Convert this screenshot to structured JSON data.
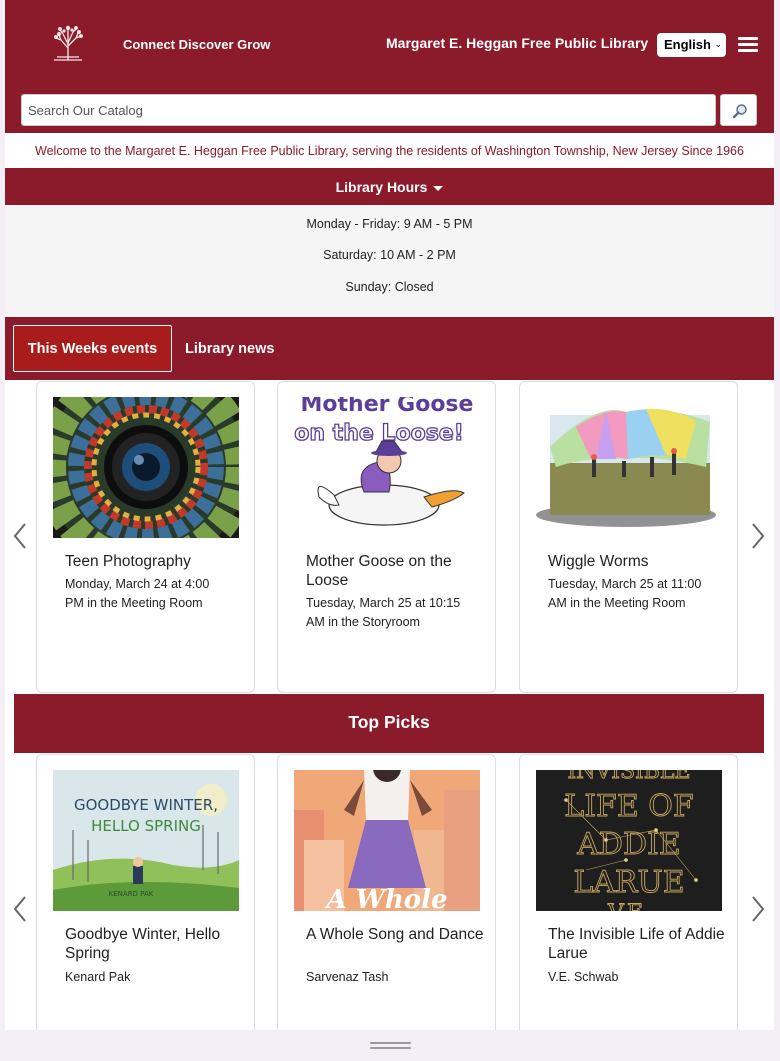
{
  "header": {
    "tagline": "Connect Discover Grow",
    "library_name": "Margaret E. Heggan Free Public Library",
    "language": "English"
  },
  "search": {
    "placeholder": "Search Our Catalog"
  },
  "welcome": "Welcome to the Margaret E. Heggan Free Public Library, serving the residents of Washington Township, New Jersey Since 1966",
  "hours": {
    "label": "Library Hours",
    "lines": [
      "Monday - Friday: 9 AM - 5 PM",
      "Saturday: 10 AM - 2 PM",
      "Sunday: Closed"
    ]
  },
  "tabs": [
    {
      "label": "This Weeks events",
      "active": true
    },
    {
      "label": "Library news",
      "active": false
    }
  ],
  "events": [
    {
      "title": "Teen Photography",
      "detail": "Monday, March 24 at 4:00 PM in the Meeting Room",
      "image": "camera-lens-mosaic"
    },
    {
      "title": "Mother Goose on the Loose",
      "detail": "Tuesday, March 25 at 10:15 AM in the Storyroom",
      "image": "mother-goose-illustration",
      "image_text": "Mother Goose on the Loose!"
    },
    {
      "title": "Wiggle Worms",
      "detail": "Tuesday, March 25 at 11:00 AM in the Meeting Room",
      "image": "parachute-play-illustration"
    }
  ],
  "top_picks": {
    "heading": "Top Picks",
    "items": [
      {
        "title": "Goodbye Winter, Hello Spring",
        "author": "Kenard Pak",
        "cover_text": [
          "GOODBYE WINTER,",
          "HELLO SPRING",
          "KENARD PAK"
        ]
      },
      {
        "title": "A Whole Song and Dance",
        "author": "Sarvenaz Tash",
        "cover_text": [
          "A Whole"
        ]
      },
      {
        "title": "The Invisible Life of Addie Larue",
        "author": "V.E. Schwab",
        "cover_text": [
          "INVISIBLE",
          "LIFE OF",
          "ADDIE",
          "LARUE",
          "V.E."
        ]
      }
    ]
  },
  "colors": {
    "brand": "#8b1a2b",
    "active_tab": "#a81c1c",
    "hours_bg": "#f5f5f5"
  },
  "icons": [
    "library-tree-logo-icon",
    "menu-icon",
    "search-icon",
    "chevron-left-icon",
    "chevron-right-icon",
    "caret-down-icon"
  ]
}
